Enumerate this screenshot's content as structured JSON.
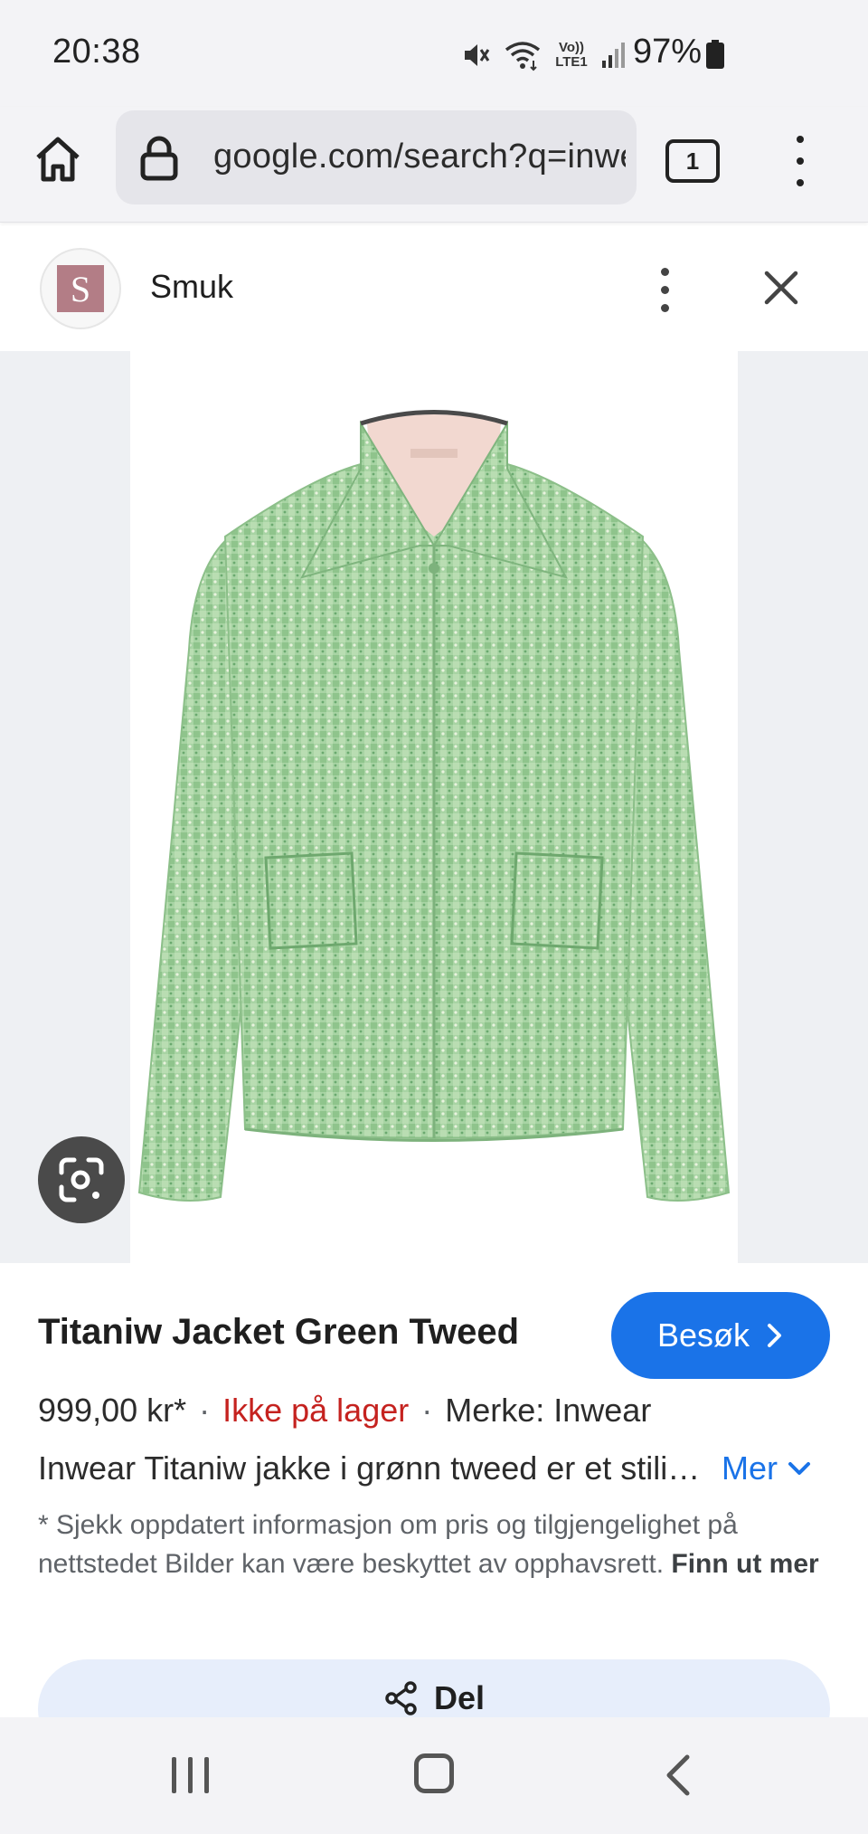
{
  "status_bar": {
    "time": "20:38",
    "battery": "97%",
    "network_label": "Vo)) LTE1",
    "icons": [
      "mute-icon",
      "wifi-icon",
      "volte-icon",
      "signal-icon",
      "battery-icon"
    ]
  },
  "browser": {
    "url": "google.com/search?q=inwear+titaniw",
    "tab_count": "1",
    "icons": [
      "home-icon",
      "lock-icon",
      "tabs-icon",
      "menu-icon"
    ]
  },
  "source": {
    "favicon_letter": "S",
    "name": "Smuk",
    "favicon_color": "#b37d86"
  },
  "product": {
    "title": "Titaniw Jacket Green Tweed",
    "visit_label": "Besøk",
    "price": "999,00 kr*",
    "stock": "Ikke på lager",
    "brand": "Merke: Inwear",
    "description": "Inwear Titaniw jakke i grønn tweed er et stilig valg",
    "more_label": "Mer",
    "disclaimer": "* Sjekk oppdatert informasjon om pris og tilgjengelighet på nettstedet Bilder kan være beskyttet av opphavsrett.",
    "learn_more": "Finn ut mer",
    "share_label": "Del",
    "image_colors": {
      "tweed": "#9fcf9f",
      "lining": "#f2d8d0"
    }
  },
  "colors": {
    "accent": "#1a73e8",
    "out_of_stock": "#c5221f",
    "share_bg": "#e7eefb"
  }
}
